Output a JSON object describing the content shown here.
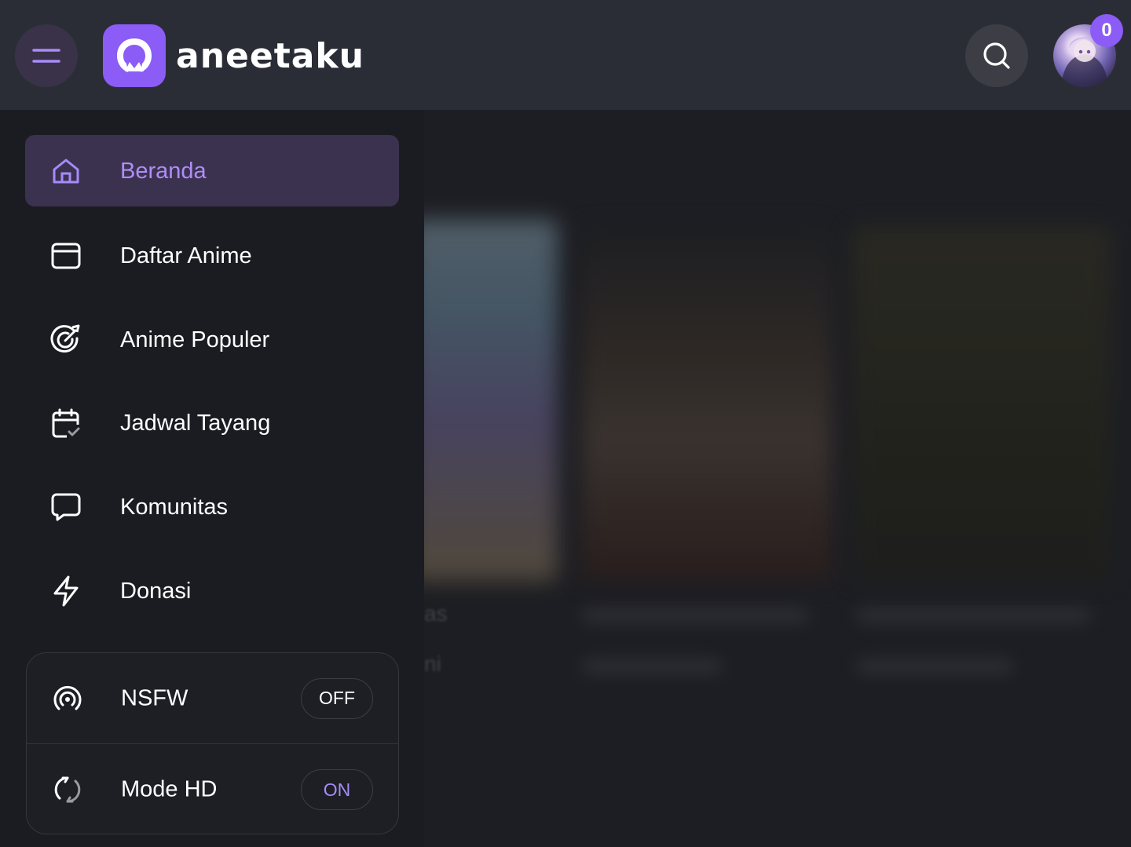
{
  "header": {
    "logo_text": "aneetaku",
    "notification_count": "0"
  },
  "sidebar": {
    "items": [
      {
        "label": "Beranda",
        "icon": "home-icon",
        "active": true
      },
      {
        "label": "Daftar Anime",
        "icon": "browser-window-icon"
      },
      {
        "label": "Anime Populer",
        "icon": "target-icon"
      },
      {
        "label": "Jadwal Tayang",
        "icon": "calendar-check-icon"
      },
      {
        "label": "Komunitas",
        "icon": "chat-bubble-icon"
      },
      {
        "label": "Donasi",
        "icon": "lightning-icon"
      }
    ],
    "settings": [
      {
        "label": "NSFW",
        "value": "OFF",
        "icon": "broadcast-icon"
      },
      {
        "label": "Mode HD",
        "value": "ON",
        "icon": "refresh-icon"
      }
    ]
  },
  "background": {
    "partial_text_1": "as",
    "partial_text_2": "ni"
  },
  "colors": {
    "accent": "#8b5cf6",
    "active_text": "#b08df6",
    "header_bg": "#2b2d36",
    "sidebar_bg": "#1b1c22"
  }
}
